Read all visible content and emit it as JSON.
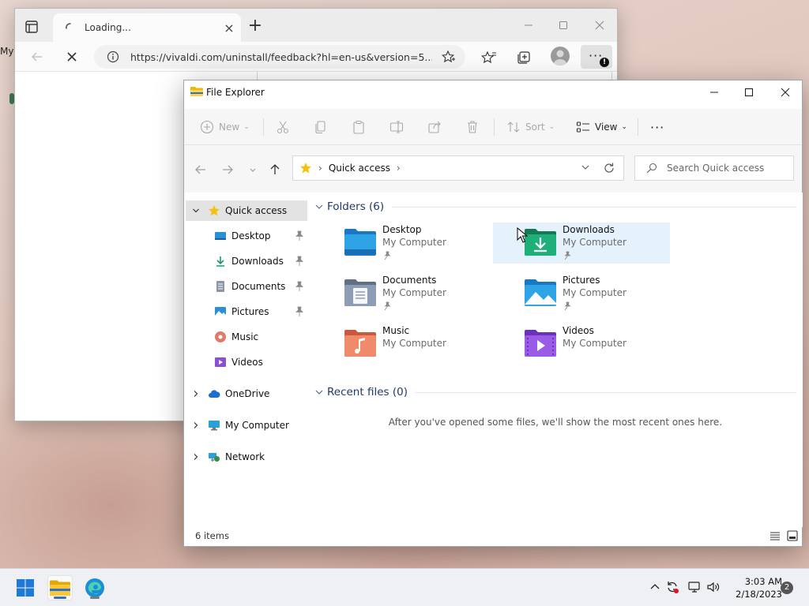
{
  "desktop": {
    "label_fragment": "My"
  },
  "browser": {
    "tab_title": "Loading...",
    "tab_close": "×",
    "new_tab": "+",
    "url": "https://vivaldi.com/uninstall/feedback?hl=en-us&version=5...",
    "menu_dots": "···",
    "menu_badge": "!"
  },
  "explorer": {
    "title": "File Explorer",
    "commands": {
      "new": "New",
      "sort": "Sort",
      "view": "View",
      "more": "···"
    },
    "address": {
      "location": "Quick access"
    },
    "search_placeholder": "Search Quick access",
    "nav": [
      {
        "label": "Quick access"
      },
      {
        "label": "Desktop"
      },
      {
        "label": "Downloads"
      },
      {
        "label": "Documents"
      },
      {
        "label": "Pictures"
      },
      {
        "label": "Music"
      },
      {
        "label": "Videos"
      },
      {
        "label": "OneDrive"
      },
      {
        "label": "My Computer"
      },
      {
        "label": "Network"
      }
    ],
    "folders_header": "Folders (6)",
    "folders": [
      {
        "name": "Desktop",
        "location": "My Computer"
      },
      {
        "name": "Downloads",
        "location": "My Computer"
      },
      {
        "name": "Documents",
        "location": "My Computer"
      },
      {
        "name": "Pictures",
        "location": "My Computer"
      },
      {
        "name": "Music",
        "location": "My Computer"
      },
      {
        "name": "Videos",
        "location": "My Computer"
      }
    ],
    "recent_header": "Recent files (0)",
    "recent_empty": "After you've opened some files, we'll show the most recent ones here.",
    "status_count": "6 items"
  },
  "taskbar": {
    "time": "3:03 AM",
    "date": "2/18/2023",
    "notifications": "2"
  },
  "colors": {
    "accent": "#0067c0",
    "folder_blue": "#1e90d6",
    "selection": "#e5f1fb"
  }
}
